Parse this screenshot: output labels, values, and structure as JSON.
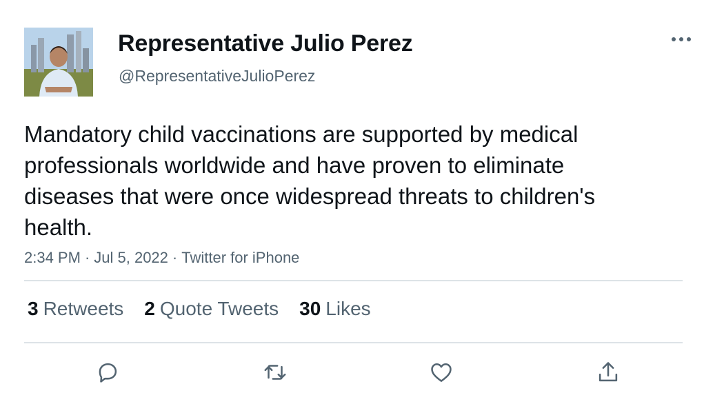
{
  "author": {
    "display_name": "Representative Julio Perez",
    "handle": "@RepresentativeJulioPerez"
  },
  "tweet": {
    "text": "Mandatory child vaccinations are supported by medical professionals worldwide and have proven to eliminate diseases that were once widespread threats to children's health.",
    "time": "2:34 PM",
    "separator": "·",
    "date": "Jul 5, 2022",
    "source": "Twitter for iPhone"
  },
  "stats": [
    {
      "count": "3",
      "label": "Retweets"
    },
    {
      "count": "2",
      "label": "Quote Tweets"
    },
    {
      "count": "30",
      "label": "Likes"
    }
  ],
  "icons": {
    "more": "more-dots-icon",
    "reply": "reply-icon",
    "retweet": "retweet-icon",
    "like": "like-icon",
    "share": "share-icon"
  },
  "colors": {
    "text": "#0f1419",
    "secondary": "#536471",
    "divider": "#dde3e7"
  }
}
